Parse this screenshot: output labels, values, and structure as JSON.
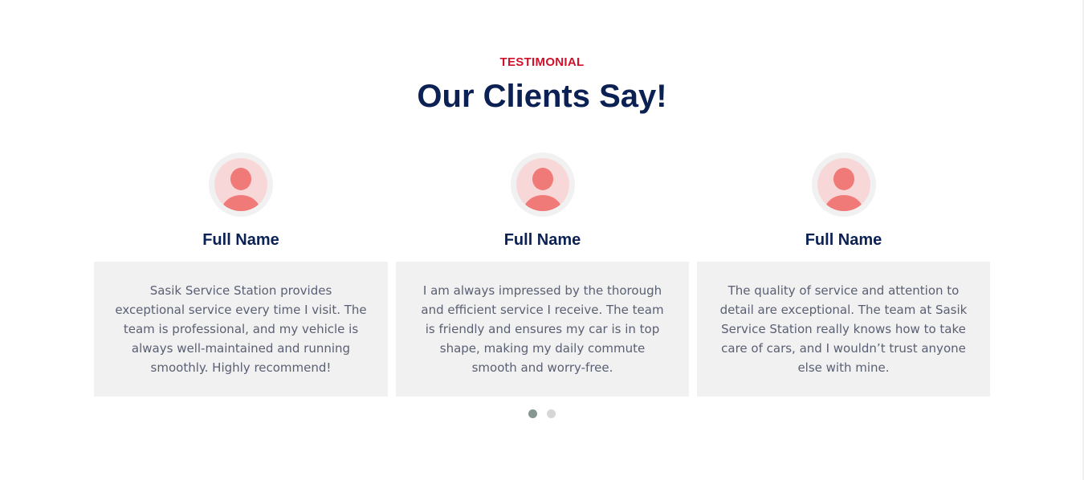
{
  "section": {
    "eyebrow": "TESTIMONIAL",
    "title": "Our Clients Say!"
  },
  "testimonials": [
    {
      "name": "Full Name",
      "avatar_icon": "user-avatar-icon",
      "quote": "Sasik Service Station provides exceptional service every time I visit. The team is professional, and my vehicle is always well-maintained and running smoothly. Highly recommend!"
    },
    {
      "name": "Full Name",
      "avatar_icon": "user-avatar-icon",
      "quote": "I am always impressed by the thorough and efficient service I receive. The team is friendly and ensures my car is in top shape, making my daily commute smooth and worry-free."
    },
    {
      "name": "Full Name",
      "avatar_icon": "user-avatar-icon",
      "quote": "The quality of service and attention to detail are exceptional. The team at Sasik Service Station really knows how to take care of cars, and I wouldn’t trust anyone else with mine."
    }
  ],
  "carousel": {
    "pages": 2,
    "active_page": 1
  },
  "colors": {
    "accent": "#d0112b",
    "heading": "#0b2154",
    "text": "#5a6073",
    "card_bg": "#f1f1f1",
    "avatar_bg": "#f8d7d9",
    "avatar_figure": "#ef7a77",
    "dot_active": "#869791",
    "dot_inactive": "#d6d6d6"
  }
}
